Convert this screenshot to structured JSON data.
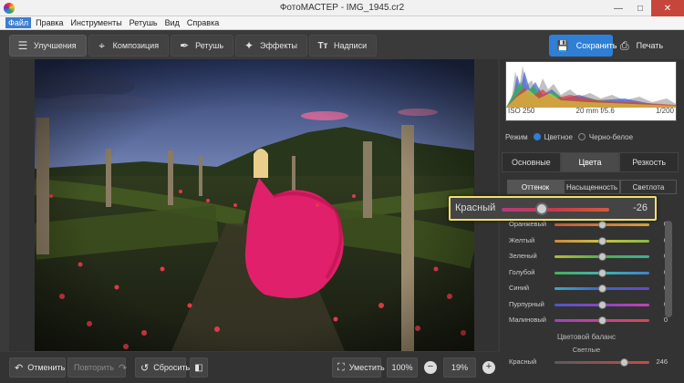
{
  "window": {
    "title": "ФотоМАСТЕР - IMG_1945.cr2"
  },
  "menu": [
    "Файл",
    "Правка",
    "Инструменты",
    "Ретушь",
    "Вид",
    "Справка"
  ],
  "tabs": [
    {
      "label": "Улучшения",
      "icon": "sliders-icon"
    },
    {
      "label": "Композиция",
      "icon": "crop-icon"
    },
    {
      "label": "Ретушь",
      "icon": "brush-icon"
    },
    {
      "label": "Эффекты",
      "icon": "magic-wand-icon"
    },
    {
      "label": "Надписи",
      "icon": "text-icon"
    }
  ],
  "actions": {
    "save": "Сохранить",
    "print": "Печать"
  },
  "bottom": {
    "undo": "Отменить",
    "redo": "Повторить",
    "reset": "Сбросить",
    "fit": "Уместить",
    "zoom_preset": "100%",
    "zoom": "19%"
  },
  "histogram": {
    "iso": "ISO 250",
    "lens": "20 mm f/5.6",
    "shutter": "1/200"
  },
  "mode": {
    "label": "Режим",
    "color": "Цветное",
    "bw": "Черно-белое",
    "selected": "color"
  },
  "panel_tabs": [
    "Основные",
    "Цвета",
    "Резкость"
  ],
  "sub_tabs": [
    "Оттенок",
    "Насыщенность",
    "Светлота"
  ],
  "highlight": {
    "label": "Красный",
    "value": "-26",
    "level": -26
  },
  "sliders": [
    {
      "label": "Оранжевый",
      "value": "0",
      "gradient": "linear-gradient(90deg,#c25a3e,#d9a03b)"
    },
    {
      "label": "Желтый",
      "value": "0",
      "gradient": "linear-gradient(90deg,#d08a3a,#c9c23e,#8bb83f)"
    },
    {
      "label": "Зеленый",
      "value": "0",
      "gradient": "linear-gradient(90deg,#b8b840,#4fae4a,#3fae9a)"
    },
    {
      "label": "Голубой",
      "value": "0",
      "gradient": "linear-gradient(90deg,#4aae5a,#3fb3b3,#3f83c9)"
    },
    {
      "label": "Синий",
      "value": "0",
      "gradient": "linear-gradient(90deg,#3fa8c0,#3f62c9,#6a49c2)"
    },
    {
      "label": "Пурпурный",
      "value": "0",
      "gradient": "linear-gradient(90deg,#4e58c6,#8a46c2,#c243b1)"
    },
    {
      "label": "Малиновый",
      "value": "0",
      "gradient": "linear-gradient(90deg,#9a45c0,#c8428f,#cf4a5a)"
    }
  ],
  "color_balance": {
    "title": "Цветовой баланс",
    "sub": "Светлые",
    "label": "Красный",
    "value": "246"
  },
  "colors": {
    "accent": "#2f7fd6",
    "highlight_border": "#f3e06a",
    "dress": "#e0206a"
  }
}
